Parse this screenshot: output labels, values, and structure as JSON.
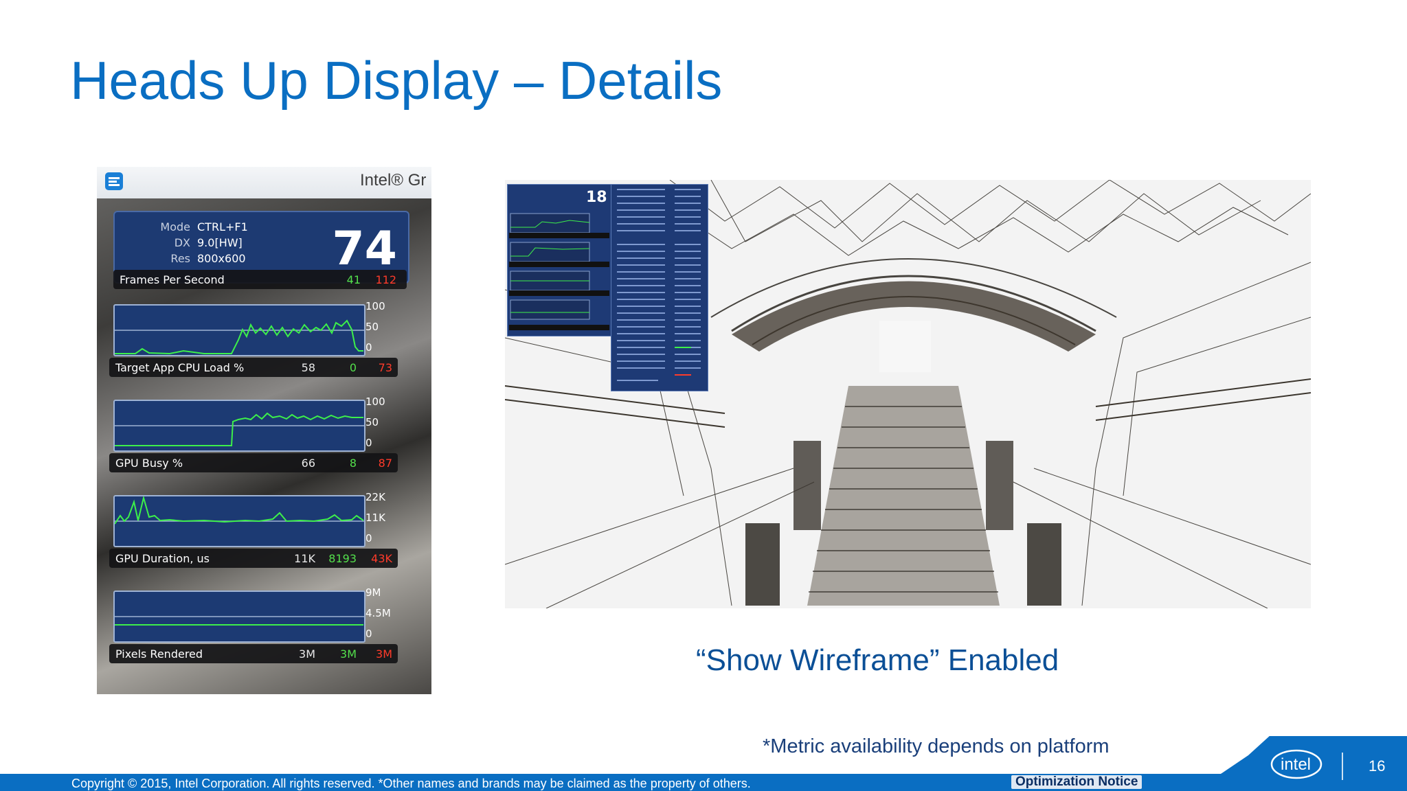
{
  "slide": {
    "title": "Heads Up Display – Details",
    "caption": "“Show Wireframe” Enabled",
    "note": "*Metric availability depends on platform",
    "page_number": "16",
    "copyright": "Copyright © 2015, Intel Corporation. All rights reserved. *Other names and brands may be claimed as the property of others.",
    "optimization_notice": "Optimization Notice",
    "colors": {
      "title": "#0a6ec2",
      "footer": "#0a6ec2",
      "caption": "#0b4f96"
    }
  },
  "hud": {
    "brand": "Intel® Gr",
    "fps": "74",
    "info": [
      {
        "key": "Mode",
        "value": "CTRL+F1"
      },
      {
        "key": "DX",
        "value": "9.0[HW]"
      },
      {
        "key": "Res",
        "value": "800x600"
      }
    ],
    "frames": {
      "label": "Frames Per Second",
      "current": "",
      "min": "41",
      "max": "112"
    },
    "metrics": [
      {
        "label": "Target App CPU Load %",
        "current": "58",
        "min": "0",
        "max": "73",
        "ticks": [
          "100",
          "50",
          "0"
        ],
        "refline": 0.5
      },
      {
        "label": "GPU Busy %",
        "current": "66",
        "min": "8",
        "max": "87",
        "ticks": [
          "100",
          "50",
          "0"
        ],
        "refline": 0.5
      },
      {
        "label": "GPU Duration, us",
        "current": "11K",
        "min": "8193",
        "max": "43K",
        "ticks": [
          "22K",
          "11K",
          "0"
        ],
        "refline": 0.5
      },
      {
        "label": "Pixels Rendered",
        "current": "3M",
        "min": "3M",
        "max": "3M",
        "ticks": [
          "9M",
          "4.5M",
          "0"
        ],
        "refline": 0.5
      }
    ],
    "colors": {
      "graph_bg": "#1c3a73",
      "line": "#3df04a",
      "min": "#54e04c",
      "max": "#ff3b2a"
    }
  },
  "wireframe": {
    "mini_fps": "18"
  }
}
